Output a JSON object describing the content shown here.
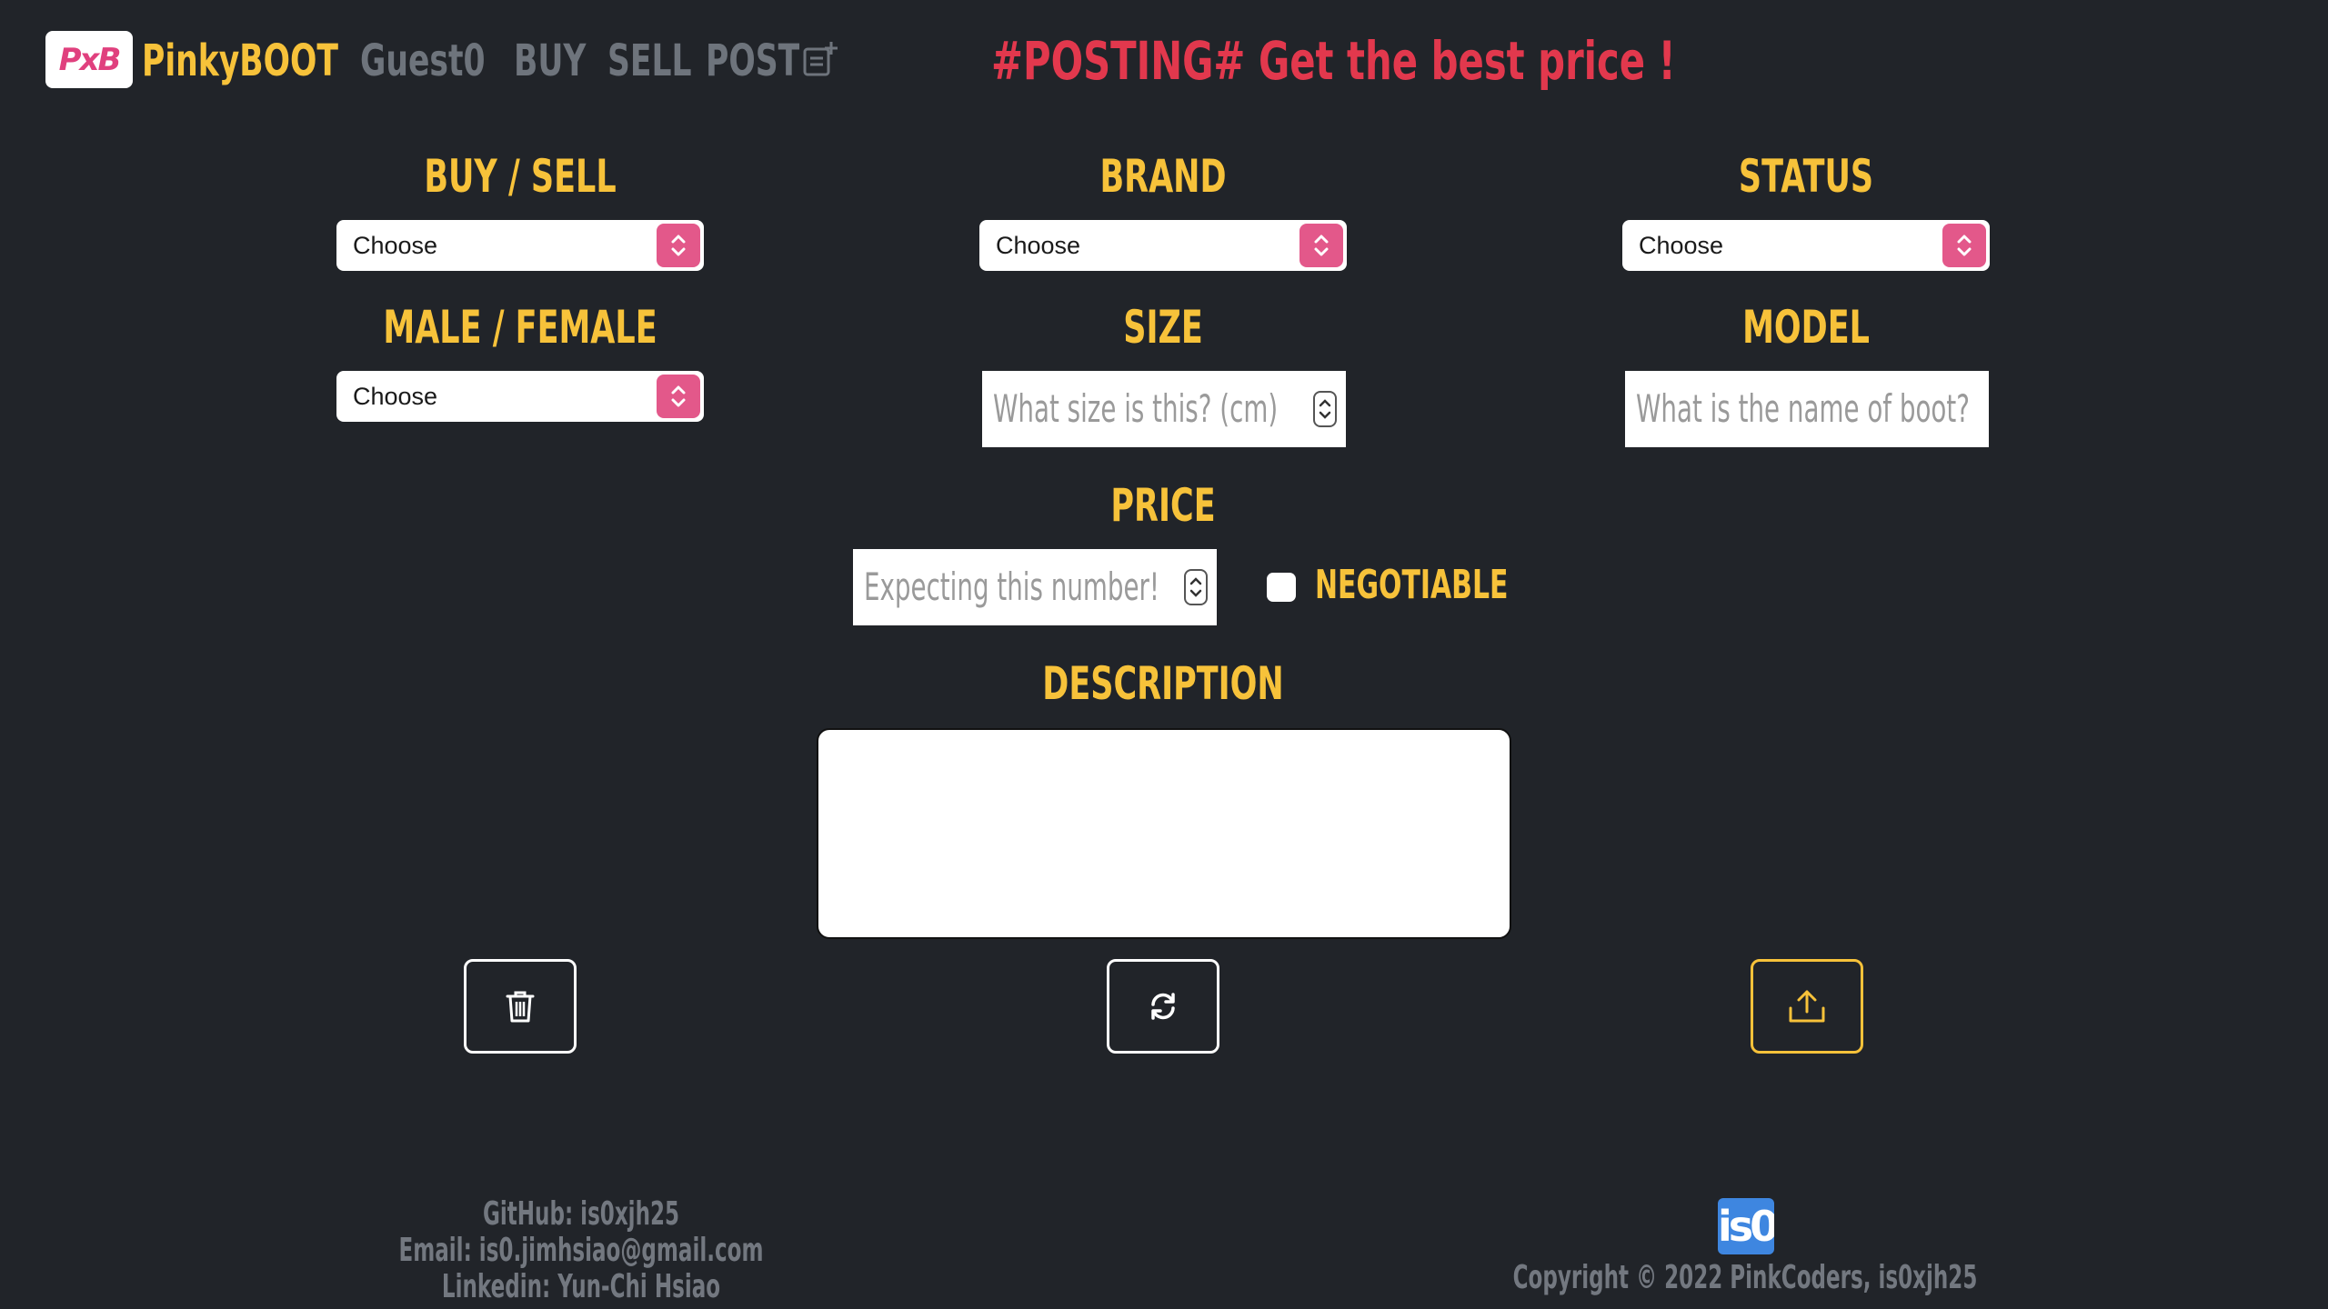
{
  "nav": {
    "logo_text": "PxB",
    "brand": "PinkyBOOT",
    "user": "Guest0",
    "buy": "BUY",
    "sell": "SELL",
    "post": "POST"
  },
  "headline": "#POSTING# Get the best price !",
  "form": {
    "buy_sell": {
      "label": "BUY / SELL",
      "value": "Choose"
    },
    "brand": {
      "label": "BRAND",
      "value": "Choose"
    },
    "status": {
      "label": "STATUS",
      "value": "Choose"
    },
    "gender": {
      "label": "MALE / FEMALE",
      "value": "Choose"
    },
    "size": {
      "label": "SIZE",
      "placeholder": "What size is this? (cm)"
    },
    "model": {
      "label": "MODEL",
      "placeholder": "What is the name of boot?"
    },
    "price": {
      "label": "PRICE",
      "placeholder": "Expecting this number!"
    },
    "negotiable": {
      "label": "NEGOTIABLE",
      "checked": false
    },
    "description": {
      "label": "DESCRIPTION",
      "value": ""
    }
  },
  "buttons": {
    "delete_icon": "trash-icon",
    "reset_icon": "refresh-icon",
    "upload_icon": "upload-icon"
  },
  "footer": {
    "github": "GitHub: is0xjh25",
    "email": "Email: is0.jimhsiao@gmail.com",
    "linkedin": "Linkedin: Yun-Chi Hsiao",
    "badge": "is0",
    "copyright": "Copyright © 2022 PinkCoders, is0xjh25"
  },
  "colors": {
    "background": "#212429",
    "accent": "#f7c23a",
    "headline": "#e2384d",
    "select_caret": "#e3588a",
    "nav_muted": "#6e747c"
  }
}
